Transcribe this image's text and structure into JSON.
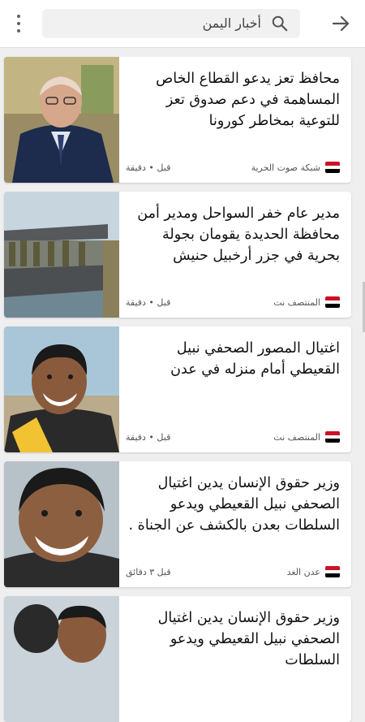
{
  "header": {
    "search_text": "أخبار اليمن"
  },
  "flag_colors": [
    "#ce1126",
    "#ffffff",
    "#000000"
  ],
  "articles": [
    {
      "headline": "محافظ تعز يدعو القطاع الخاص المساهمة في دعم صدوق تعز للتوعية بمخاطر كورونا",
      "source": "شبكة صوت الحرية",
      "time": "قبل • دقيقة"
    },
    {
      "headline": "مدير عام خفر السواحل ومدير أمن محافظة الحديدة يقومان بجولة بحرية في جزر أرخبيل حنيش",
      "source": "المنتصف نت",
      "time": "قبل • دقيقة"
    },
    {
      "headline": "اغتيال المصور الصحفي نبيل القعيطي أمام منزله في عدن",
      "source": "المنتصف نت",
      "time": "قبل • دقيقة"
    },
    {
      "headline": "وزير حقوق الإنسان يدين اغتيال الصحفي نبيل القعيطي ويدعو السلطات بعدن بالكشف عن الجناة .",
      "source": "عدن الغد",
      "time": "قبل ٣ دقائق"
    },
    {
      "headline": "وزير حقوق الإنسان يدين اغتيال الصحفي نبيل القعيطي ويدعو السلطات",
      "source": "",
      "time": ""
    }
  ]
}
